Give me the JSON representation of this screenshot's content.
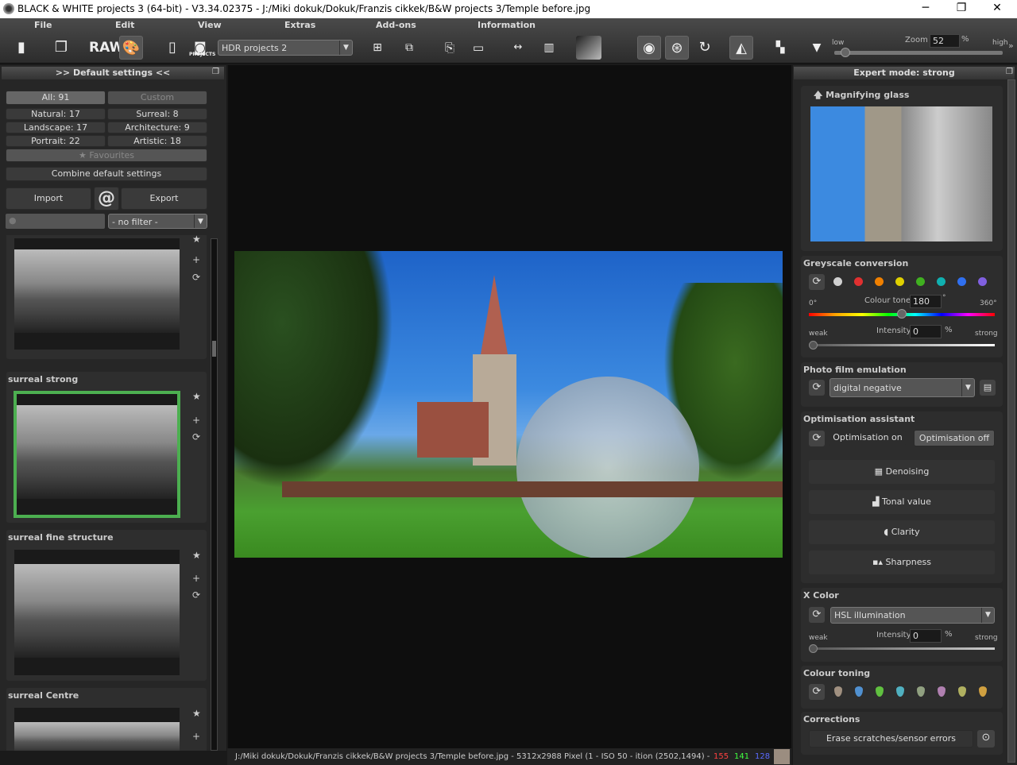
{
  "window": {
    "title": "BLACK & WHITE projects 3 (64-bit) - V3.34.02375 - J:/Miki dokuk/Dokuk/Franzis cikkek/B&W projects 3/Temple before.jpg",
    "minimize": "─",
    "maximize": "❐",
    "close": "✕"
  },
  "menu": [
    "File",
    "Edit",
    "View",
    "Extras",
    "Add-ons",
    "Information"
  ],
  "toolbar": {
    "raw_label": "RAW",
    "projects_label": "PROJECTS",
    "project_combo": "HDR projects 2",
    "zoom_label": "Zoom",
    "zoom_value": "52",
    "zoom_unit": "%",
    "low": "low",
    "high": "high",
    "more": "»",
    "zoom_level": 0.05
  },
  "left_panel": {
    "title": ">> Default settings <<",
    "filters": [
      "All: 91",
      "Custom",
      "Natural: 17",
      "Surreal: 8",
      "Landscape: 17",
      "Architecture: 9",
      "Portrait: 22",
      "Artistic: 18"
    ],
    "favourites": "Favourites",
    "combine": "Combine default settings",
    "import": "Import",
    "at": "@",
    "export": "Export",
    "search_placeholder": "",
    "filter_select": "- no filter -",
    "presets": [
      {
        "label": ""
      },
      {
        "label": "surreal strong",
        "selected": true
      },
      {
        "label": "surreal fine structure"
      },
      {
        "label": "surreal Centre"
      }
    ]
  },
  "right_panel": {
    "title": "Expert mode: strong",
    "magnifier": "Magnifying glass",
    "greyscale": {
      "title": "Greyscale conversion",
      "swatches": [
        "#d0d0d0",
        "#e03030",
        "#f08000",
        "#e0d000",
        "#40b020",
        "#10b0b0",
        "#3070f0",
        "#8060e0"
      ],
      "min": "0°",
      "max": "360°",
      "tone_label": "Colour tone",
      "tone_value": "180",
      "tone_unit": "°",
      "weak": "weak",
      "strong": "strong",
      "intensity_label": "Intensity",
      "intensity_value": "0",
      "intensity_unit": "%"
    },
    "film": {
      "title": "Photo film emulation",
      "value": "digital negative"
    },
    "optimisation": {
      "title": "Optimisation assistant",
      "on": "Optimisation on",
      "off": "Optimisation off",
      "items": [
        "Denoising",
        "Tonal value",
        "Clarity",
        "Sharpness"
      ]
    },
    "xcolor": {
      "title": "X Color",
      "value": "HSL illumination",
      "weak": "weak",
      "strong": "strong",
      "intensity_label": "Intensity",
      "intensity_value": "0",
      "intensity_unit": "%"
    },
    "toning": {
      "title": "Colour toning",
      "drops": [
        "#a09080",
        "#5090d0",
        "#60c040",
        "#50b0c0",
        "#90a080",
        "#b080b0",
        "#b0b060",
        "#d0a040"
      ]
    },
    "corrections": {
      "title": "Corrections",
      "erase": "Erase scratches/sensor errors"
    }
  },
  "status": {
    "text": "J:/Miki dokuk/Dokuk/Franzis cikkek/B&W projects 3/Temple before.jpg - 5312x2988 Pixel (1   - ISO 50 -  ition   (2502,1494) -",
    "r": "155",
    "g": "141",
    "b": "128",
    "r_color": "#ff4040",
    "g_color": "#40ff40",
    "b_color": "#5a6aff",
    "swatch": "#9b8d80"
  }
}
